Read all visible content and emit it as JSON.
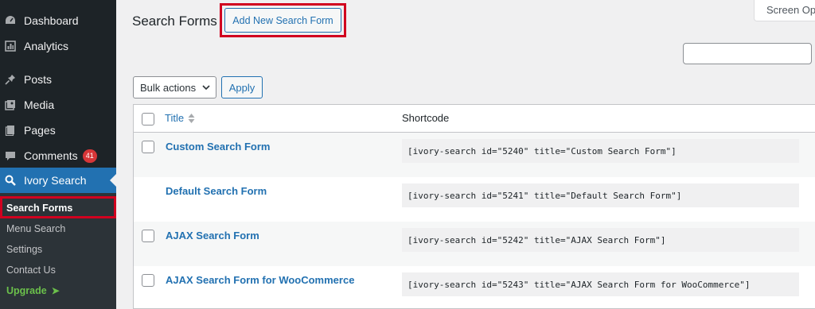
{
  "sidebar": {
    "items": [
      {
        "label": "Dashboard",
        "icon": "dashboard-icon"
      },
      {
        "label": "Analytics",
        "icon": "analytics-icon"
      },
      {
        "label": "Posts",
        "icon": "pin-icon"
      },
      {
        "label": "Media",
        "icon": "media-icon"
      },
      {
        "label": "Pages",
        "icon": "pages-icon"
      },
      {
        "label": "Comments",
        "icon": "comment-icon",
        "badge": "41"
      },
      {
        "label": "Ivory Search",
        "icon": "search-icon",
        "active": true
      }
    ],
    "submenu": [
      {
        "label": "Search Forms",
        "current": true
      },
      {
        "label": "Menu Search"
      },
      {
        "label": "Settings"
      },
      {
        "label": "Contact Us"
      },
      {
        "label": "Upgrade",
        "arrow": "➤"
      }
    ]
  },
  "header": {
    "title": "Search Forms",
    "add_new_label": "Add New Search Form",
    "screen_options_label": "Screen Opt"
  },
  "search": {
    "value": ""
  },
  "bulk": {
    "selected": "Bulk actions",
    "apply_label": "Apply"
  },
  "table": {
    "columns": {
      "title": "Title",
      "shortcode": "Shortcode"
    },
    "rows": [
      {
        "title": "Custom Search Form",
        "shortcode": "[ivory-search id=\"5240\" title=\"Custom Search Form\"]",
        "has_checkbox": true
      },
      {
        "title": "Default Search Form",
        "shortcode": "[ivory-search id=\"5241\" title=\"Default Search Form\"]",
        "has_checkbox": false
      },
      {
        "title": "AJAX Search Form",
        "shortcode": "[ivory-search id=\"5242\" title=\"AJAX Search Form\"]",
        "has_checkbox": true
      },
      {
        "title": "AJAX Search Form for WooCommerce",
        "shortcode": "[ivory-search id=\"5243\" title=\"AJAX Search Form for WooCommerce\"]",
        "has_checkbox": true
      }
    ]
  },
  "colors": {
    "sidebar_bg": "#1d2327",
    "submenu_bg": "#2c3338",
    "accent": "#2271b1",
    "highlight_border": "#d1001f",
    "badge": "#d63638",
    "upgrade": "#6bc04b"
  }
}
